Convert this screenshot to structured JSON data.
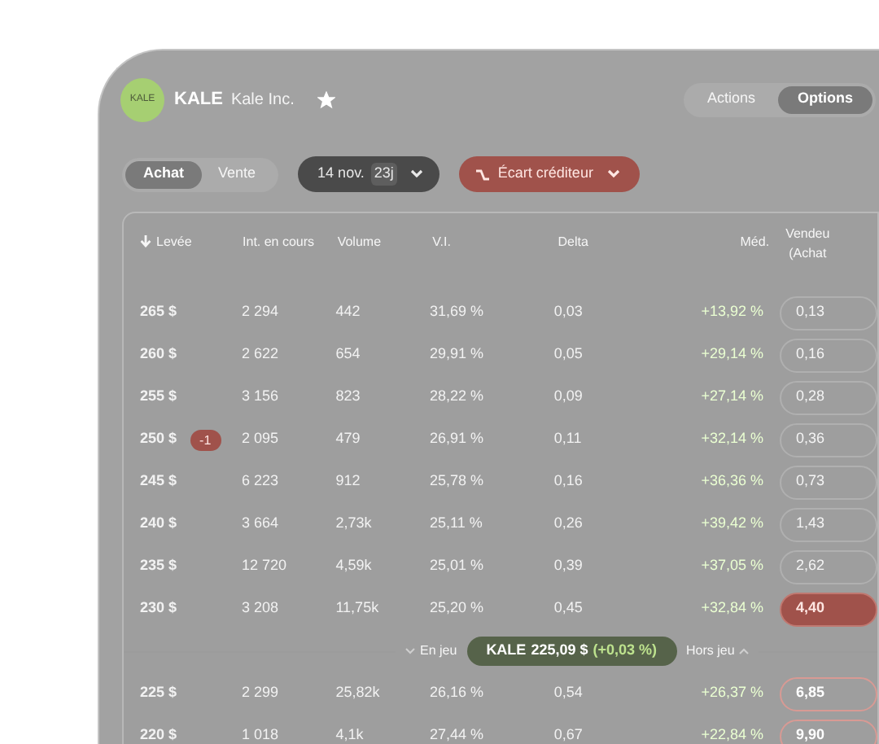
{
  "header": {
    "logo_text": "KALE",
    "ticker": "KALE",
    "company": "Kale Inc.",
    "favorite": true
  },
  "view_tabs": [
    {
      "label": "Actions",
      "selected": false
    },
    {
      "label": "Options",
      "selected": true
    }
  ],
  "side_tabs": [
    {
      "label": "Achat",
      "selected": true
    },
    {
      "label": "Vente",
      "selected": false
    }
  ],
  "expiry": {
    "date": "14 nov.",
    "days": "23j"
  },
  "strategy": {
    "label": "Écart créditeur"
  },
  "table": {
    "columns": [
      "Levée",
      "Int. en cours",
      "Volume",
      "V.I.",
      "Delta",
      "Méd.",
      "Vendeu\n(Achat"
    ],
    "rows": [
      {
        "strike": "265 $",
        "open_interest": "2 294",
        "volume": "442",
        "iv": "31,69 %",
        "delta": "0,03",
        "median": "+13,92 %",
        "price": "0,13",
        "selected": false,
        "in_the_money": false
      },
      {
        "strike": "260 $",
        "open_interest": "2 622",
        "volume": "654",
        "iv": "29,91 %",
        "delta": "0,05",
        "median": "+29,14 %",
        "price": "0,16",
        "selected": false,
        "in_the_money": false
      },
      {
        "strike": "255 $",
        "open_interest": "3 156",
        "volume": "823",
        "iv": "28,22 %",
        "delta": "0,09",
        "median": "+27,14 %",
        "price": "0,28",
        "selected": false,
        "in_the_money": false
      },
      {
        "strike": "250 $",
        "badge": "-1",
        "open_interest": "2 095",
        "volume": "479",
        "iv": "26,91 %",
        "delta": "0,11",
        "median": "+32,14 %",
        "price": "0,36",
        "selected": false,
        "in_the_money": false
      },
      {
        "strike": "245 $",
        "open_interest": "6 223",
        "volume": "912",
        "iv": "25,78 %",
        "delta": "0,16",
        "median": "+36,36 %",
        "price": "0,73",
        "selected": false,
        "in_the_money": false
      },
      {
        "strike": "240 $",
        "open_interest": "3 664",
        "volume": "2,73k",
        "iv": "25,11 %",
        "delta": "0,26",
        "median": "+39,42 %",
        "price": "1,43",
        "selected": false,
        "in_the_money": false
      },
      {
        "strike": "235 $",
        "open_interest": "12 720",
        "volume": "4,59k",
        "iv": "25,01 %",
        "delta": "0,39",
        "median": "+37,05 %",
        "price": "2,62",
        "selected": false,
        "in_the_money": false
      },
      {
        "strike": "230 $",
        "open_interest": "3 208",
        "volume": "11,75k",
        "iv": "25,20 %",
        "delta": "0,45",
        "median": "+32,84 %",
        "price": "4,40",
        "selected": true,
        "in_the_money": false
      },
      {
        "kind": "divider",
        "left": "En jeu",
        "ticker": "KALE",
        "quote": "225,09 $",
        "change": "(+0,03 %)",
        "right": "Hors jeu"
      },
      {
        "strike": "225 $",
        "open_interest": "2 299",
        "volume": "25,82k",
        "iv": "26,16 %",
        "delta": "0,54",
        "median": "+26,37 %",
        "price": "6,85",
        "selected": false,
        "in_the_money": true
      },
      {
        "strike": "220 $",
        "open_interest": "1 018",
        "volume": "4,1k",
        "iv": "27,44 %",
        "delta": "0,67",
        "median": "+22,84 %",
        "price": "9,90",
        "selected": false,
        "in_the_money": true
      }
    ]
  }
}
